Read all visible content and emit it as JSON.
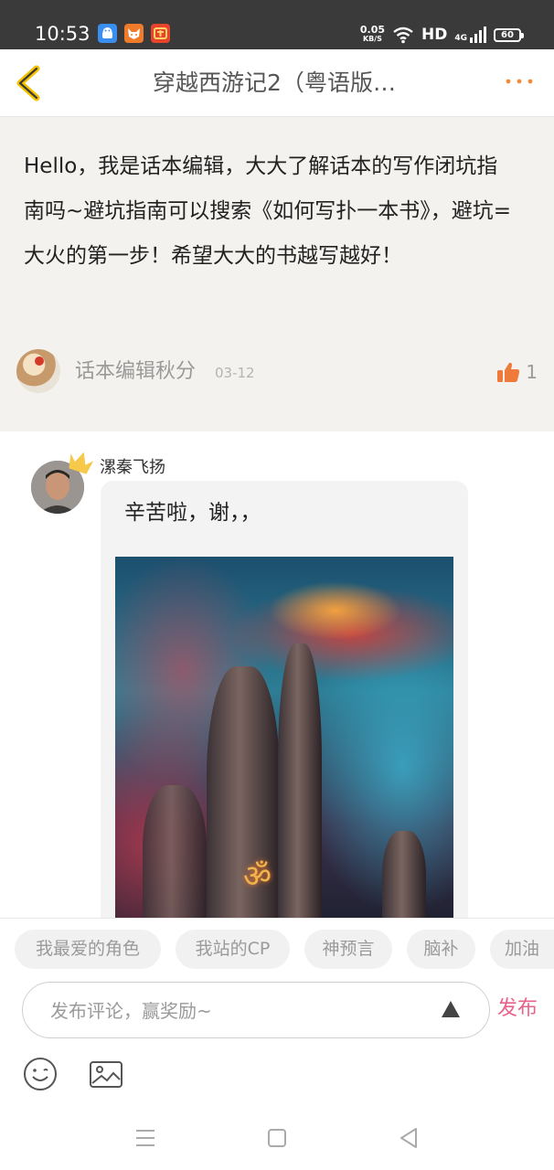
{
  "status_bar": {
    "time": "10:53",
    "net_speed_value": "0.05",
    "net_speed_unit": "KB/S",
    "hd_label": "HD",
    "signal_label": "4G",
    "battery": "60"
  },
  "header": {
    "title": "穿越西游记2（粤语版…",
    "back_icon": "chevron-left-icon",
    "more_icon": "more-dots-icon"
  },
  "editor_post": {
    "text": "Hello，我是话本编辑，大大了解话本的写作闭坑指南吗~避坑指南可以搜索《如何写扑一本书》，避坑=大火的第一步！希望大大的书越写越好！",
    "author": "话本编辑秋分",
    "date": "03-12",
    "likes": "1"
  },
  "comment": {
    "author": "漯秦飞扬",
    "text": "辛苦啦，谢，，"
  },
  "tags": [
    "我最爱的角色",
    "我站的CP",
    "神预言",
    "脑补",
    "加油"
  ],
  "input": {
    "placeholder": "发布评论，赢奖励~",
    "publish_label": "发布"
  },
  "colors": {
    "accent_orange": "#f08a3c",
    "publish_pink": "#e9628a",
    "editor_bg": "#f3f2ee"
  }
}
